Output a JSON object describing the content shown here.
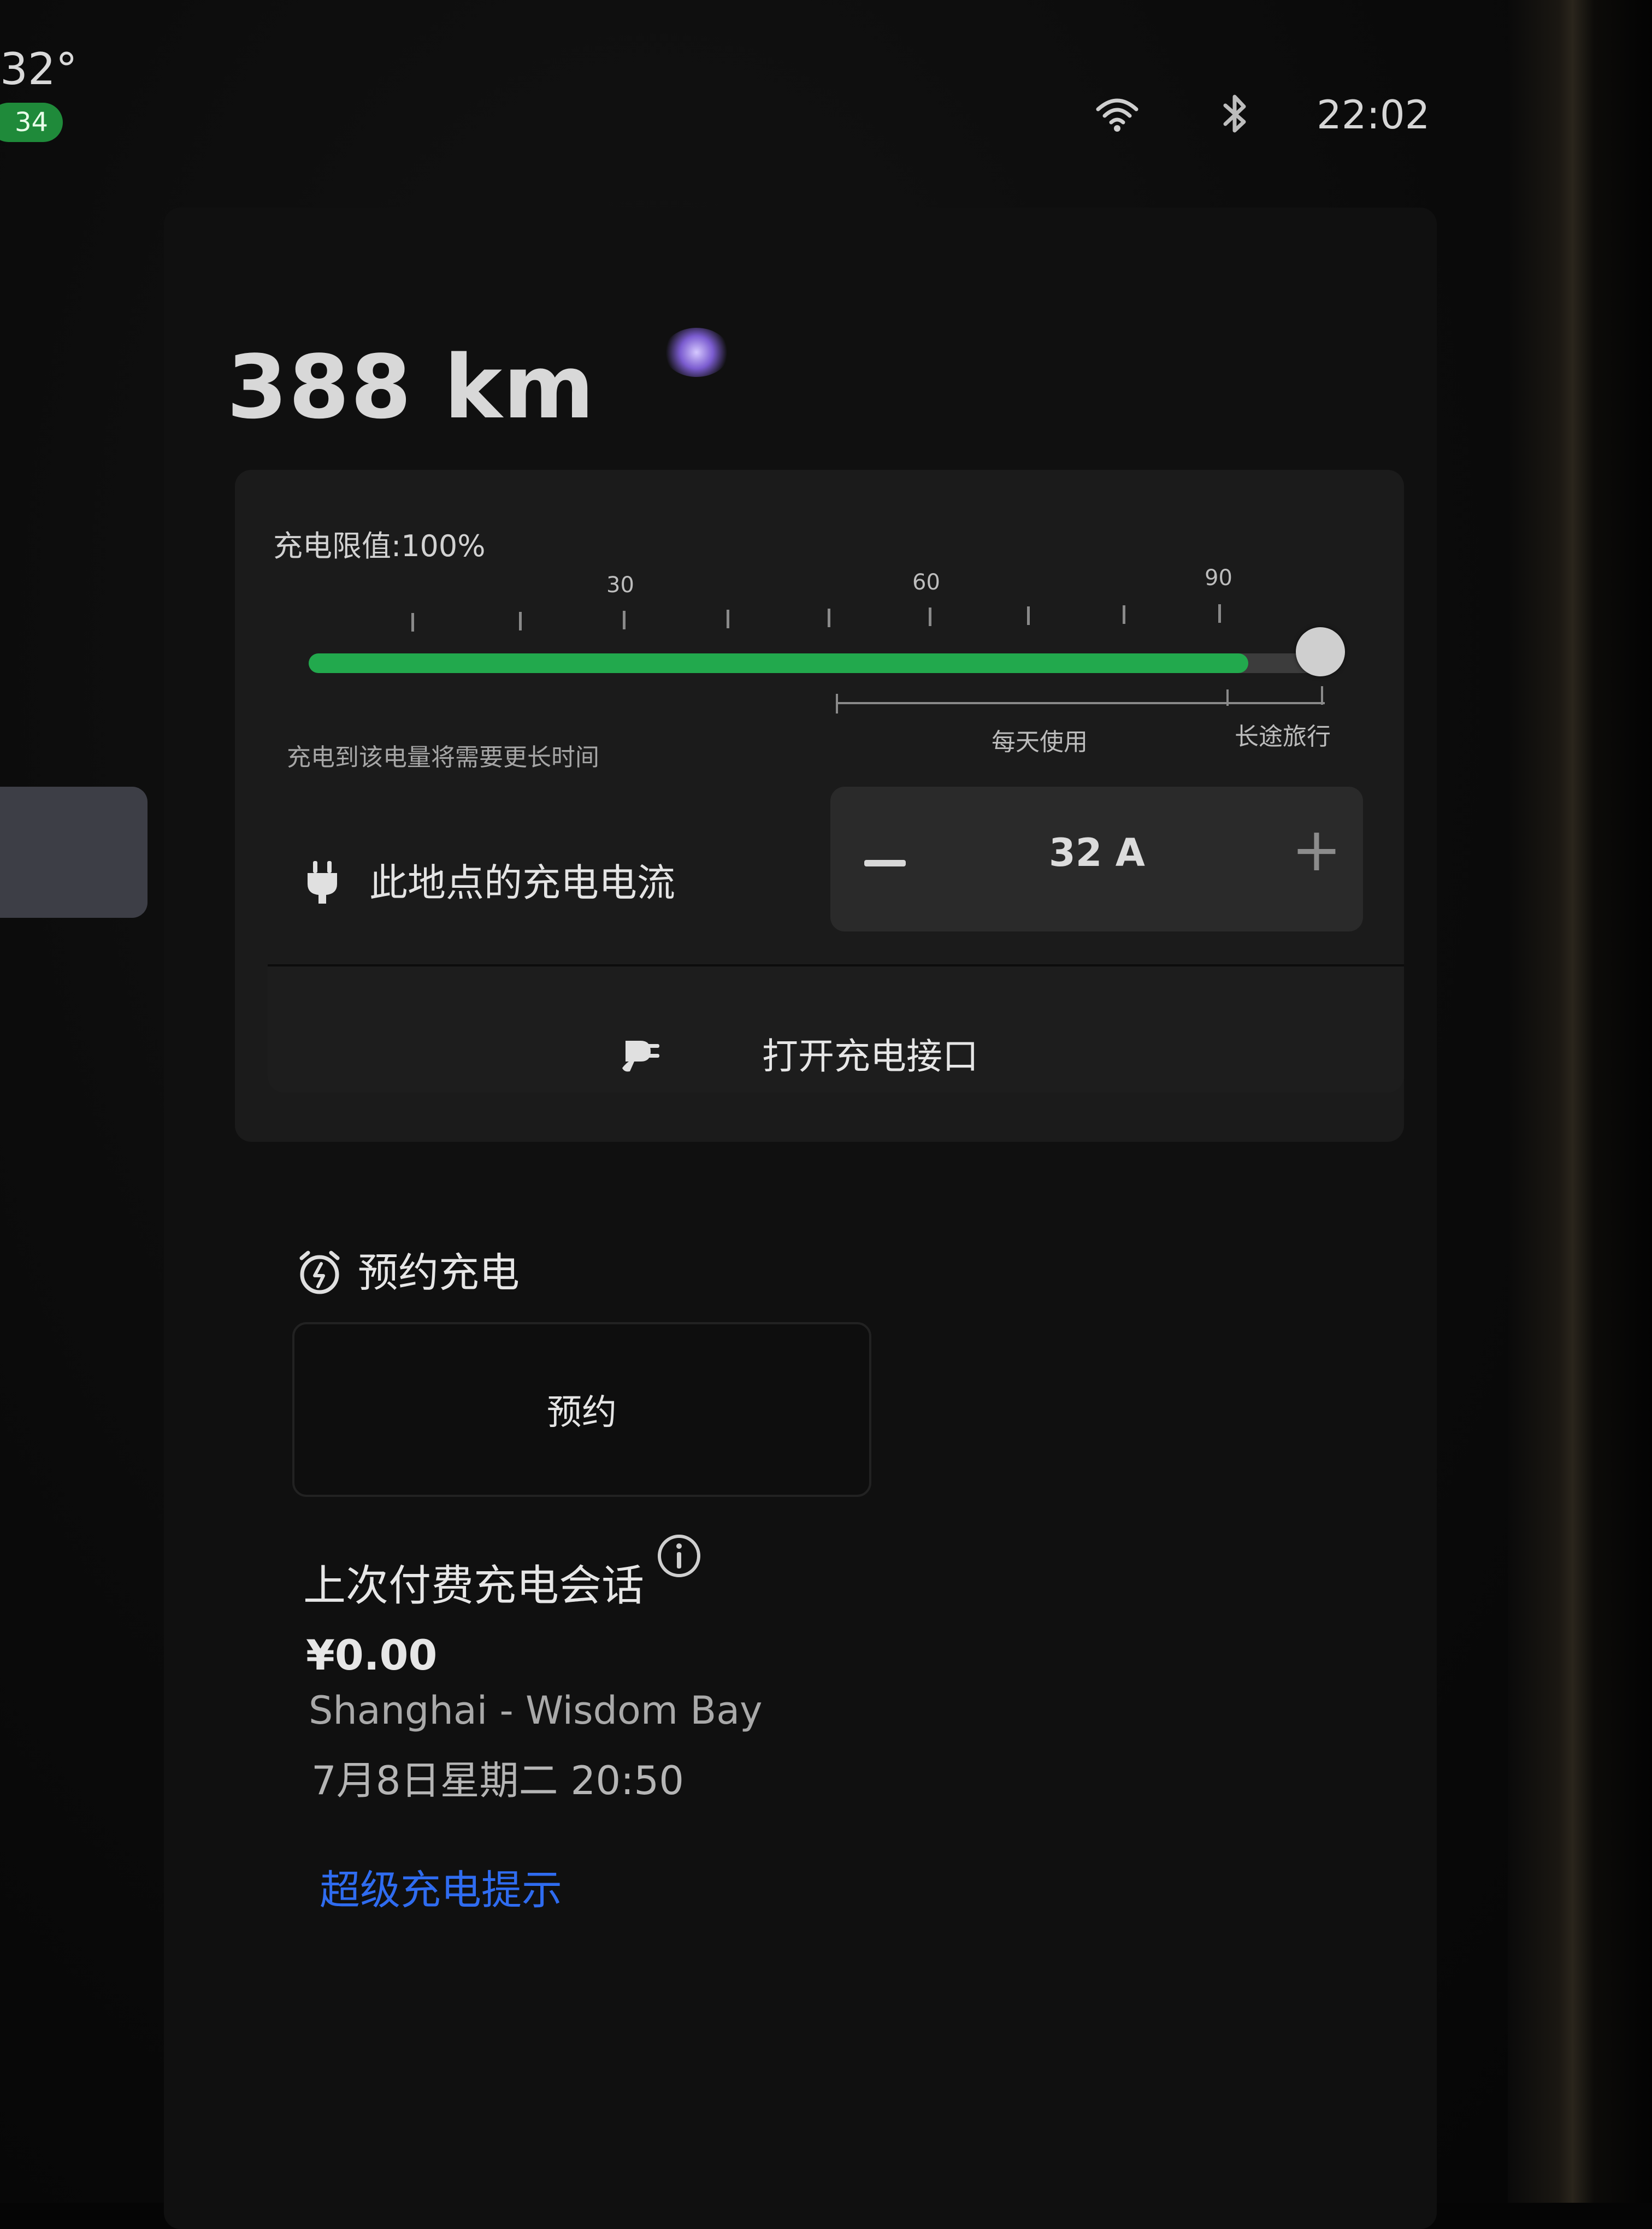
{
  "status_bar": {
    "temperature": "32°",
    "aqi": "34",
    "time": "22:02",
    "icons": [
      "wifi-icon",
      "bluetooth-icon"
    ]
  },
  "charging": {
    "range": "388 km",
    "limit_label": "充电限值:100%",
    "limit_percent": 100,
    "ticks": [
      "30",
      "60",
      "90"
    ],
    "hint": "充电到该电量将需要更长时间",
    "daily_label": "每天使用",
    "trip_label": "长途旅行",
    "current_label": "此地点的充电电流",
    "current_value": "32 A",
    "minus_label": "−",
    "plus_label": "+",
    "open_port_label": "打开充电接口"
  },
  "schedule": {
    "title": "预约充电",
    "button_label": "预约"
  },
  "last_session": {
    "title": "上次付费充电会话",
    "amount": "¥0.00",
    "location": "Shanghai - Wisdom Bay",
    "datetime": "7月8日星期二 20:50"
  },
  "links": {
    "supercharge_tips": "超级充电提示"
  },
  "colors": {
    "accent_green": "#22a94d",
    "link_blue": "#2f6cf0",
    "aqi_green": "#1f8a3a"
  }
}
